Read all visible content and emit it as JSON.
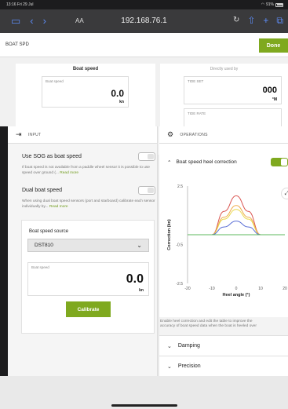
{
  "status_bar": {
    "time": "13:16",
    "date": "Fri 29 Jul",
    "battery": "91%"
  },
  "browser": {
    "text_size": "AA",
    "url": "192.168.76.1"
  },
  "page": {
    "title": "BOAT SPD",
    "done_label": "Done"
  },
  "boat_speed_card": {
    "header": "Boat speed",
    "field_label": "Boat speed",
    "value": "0.0",
    "unit": "kn"
  },
  "used_by_card": {
    "header": "Directly used by",
    "tide_set": {
      "label": "TIDE SET",
      "value": "000",
      "unit": "°M"
    },
    "tide_rate": {
      "label": "TIDE RATE"
    }
  },
  "input_panel": {
    "header": "INPUT",
    "sog": {
      "label": "Use SOG as boat speed",
      "help": "If boat speed is not available from a paddle wheel sensor it is possible to use speed over ground (...",
      "more": "Read more"
    },
    "dual": {
      "label": "Dual boat speed",
      "help": "When using dual boat speed sensors (port and starboard) calibrate each sensor individually by...",
      "more": "Read more"
    },
    "source": {
      "label": "Boat speed source",
      "selected": "DST810",
      "speed_label": "Boat speed",
      "speed_value": "0.0",
      "speed_unit": "kn",
      "calibrate_label": "Calibrate"
    }
  },
  "ops_panel": {
    "header": "OPERATIONS",
    "heel_correction": {
      "label": "Boat speed heel correction",
      "enabled": true
    },
    "help_line1": "Enable heel correction and edit the table to improve the",
    "help_line2": "accuracy of boat speed data when the boat is heeled over",
    "damping_label": "Damping",
    "precision_label": "Precision"
  },
  "chart_data": {
    "type": "line",
    "xlabel": "Heel angle (°)",
    "ylabel": "Correction (kn)",
    "xlim": [
      -20,
      20
    ],
    "ylim": [
      -2.5,
      2.5
    ],
    "x_ticks": [
      "-20",
      "-10",
      "0",
      "10",
      "20"
    ],
    "y_ticks": [
      "2.5",
      "-0.5",
      "-2.5"
    ],
    "x": [
      -20,
      -15,
      -10,
      -5,
      0,
      5,
      10,
      15,
      20
    ],
    "series": [
      {
        "color": "#d9534f",
        "values": [
          0,
          0,
          0,
          1.2,
          2.0,
          1.2,
          0,
          0,
          0
        ]
      },
      {
        "color": "#f0ad4e",
        "values": [
          0,
          0,
          0,
          0.9,
          1.5,
          0.9,
          0,
          0,
          0
        ]
      },
      {
        "color": "#e8d84a",
        "values": [
          0,
          0,
          0,
          0.8,
          1.3,
          0.8,
          0,
          0,
          0
        ]
      },
      {
        "color": "#5b6fd6",
        "values": [
          0,
          0,
          0,
          0.4,
          0.7,
          0.4,
          0,
          0,
          0
        ]
      },
      {
        "color": "#5cb85c",
        "values": [
          0,
          0,
          0,
          0,
          0,
          0,
          0,
          0,
          0
        ]
      }
    ]
  }
}
